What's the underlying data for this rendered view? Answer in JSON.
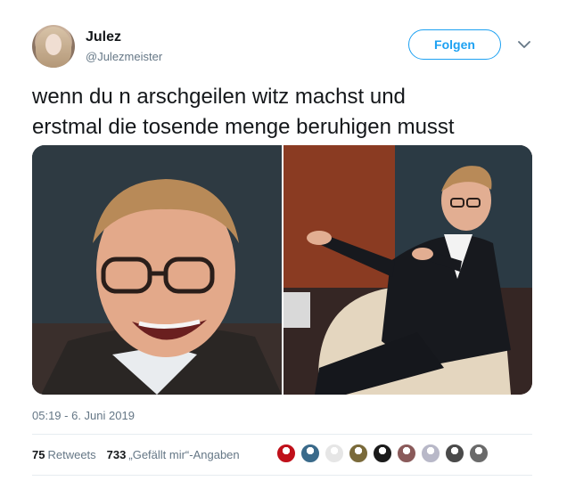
{
  "user": {
    "name": "Julez",
    "handle": "@Julezmeister"
  },
  "follow_button": {
    "label": "Folgen"
  },
  "tweet": {
    "line1": "wenn du n arschgeilen witz machst und",
    "line2": "erstmal die tosende menge beruhigen musst",
    "timestamp": "05:19 - 6. Juni 2019"
  },
  "stats": {
    "retweets_count": "75",
    "retweets_label": "Retweets",
    "likes_count": "733",
    "likes_label": "„Gefällt mir“-Angaben"
  },
  "colors": {
    "accent": "#1da1f2",
    "secondary_text": "#657786",
    "primary_text": "#14171a"
  },
  "likers": [
    {
      "color": "#c0101a"
    },
    {
      "color": "#3a6a8a"
    },
    {
      "color": "#e6e6e6"
    },
    {
      "color": "#7a6a3a"
    },
    {
      "color": "#1a1a1a"
    },
    {
      "color": "#8a5a5a"
    },
    {
      "color": "#b8b8c8"
    },
    {
      "color": "#4a4a4a"
    },
    {
      "color": "#6a6a6a"
    }
  ]
}
